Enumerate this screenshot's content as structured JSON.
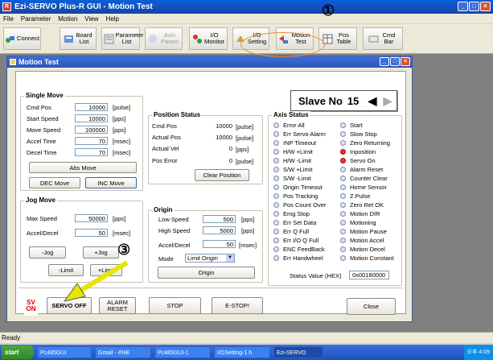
{
  "window": {
    "title": "Ezi-SERVO Plus-R GUI - Motion Test",
    "app_icon": "R"
  },
  "menu": [
    "File",
    "Parameter",
    "Motion",
    "View",
    "Help"
  ],
  "toolbar": {
    "connect": "Connect",
    "board_list": "Board List",
    "parameter_list": "Parameter List",
    "axis_param": "Axis Param",
    "io_monitor": "I/O Monitor",
    "io_setting": "I/O Setting",
    "motion_test": "Motion Test",
    "pos_table": "Pos Table",
    "cmd_bar": "Cmd Bar"
  },
  "child_window": {
    "title": "Motion Test"
  },
  "slave": {
    "label": "Slave No",
    "number": "15"
  },
  "single_move": {
    "title": "Single Move",
    "rows": [
      {
        "label": "Cmd Pos",
        "value": "10000",
        "unit": "[pulse]"
      },
      {
        "label": "Start Speed",
        "value": "10000",
        "unit": "[pps]"
      },
      {
        "label": "Move Speed",
        "value": "100000",
        "unit": "[pps]"
      },
      {
        "label": "Accel Time",
        "value": "70",
        "unit": "[msec]"
      },
      {
        "label": "Decel Time",
        "value": "70",
        "unit": "[msec]"
      }
    ],
    "abs_move": "Abs Move",
    "dec_move": "DEC Move",
    "inc_move": "INC Move"
  },
  "jog_move": {
    "title": "Jog Move",
    "rows": [
      {
        "label": "Max Speed",
        "value": "50000",
        "unit": "[pps]"
      },
      {
        "label": "Accel/Decel",
        "value": "50",
        "unit": "[msec]"
      }
    ],
    "minus_jog": "-Jog",
    "plus_jog": "+Jog",
    "minus_limit": "-Limit",
    "plus_limit": "+Limit"
  },
  "position_status": {
    "title": "Position Status",
    "rows": [
      {
        "label": "Cmd Pos",
        "value": "10000",
        "unit": "[pulse]"
      },
      {
        "label": "Actual Pos",
        "value": "10000",
        "unit": "[pulse]"
      },
      {
        "label": "Actual Vel",
        "value": "0",
        "unit": "[pps]"
      },
      {
        "label": "Pos Error",
        "value": "0",
        "unit": "[pulse]"
      }
    ],
    "clear": "Clear Position"
  },
  "origin": {
    "title": "Origin",
    "rows": [
      {
        "label": "Low Speed",
        "value": "500",
        "unit": "[pps]"
      },
      {
        "label": "High Speed",
        "value": "5000",
        "unit": "[pps]"
      },
      {
        "label": "Accel/Decel",
        "value": "50",
        "unit": "[msec]"
      }
    ],
    "mode_label": "Mode",
    "mode_value": "Limit Origin",
    "origin_button": "Origin"
  },
  "axis_status": {
    "title": "Axis Status",
    "left": [
      {
        "label": "Error All",
        "on": false
      },
      {
        "label": "Err Servo Alarm",
        "on": false
      },
      {
        "label": "INP Timeout",
        "on": false
      },
      {
        "label": "H/W +Limit",
        "on": false
      },
      {
        "label": "H/W -Limit",
        "on": false
      },
      {
        "label": "S/W +Limit",
        "on": false
      },
      {
        "label": "S/W -Limit",
        "on": false
      },
      {
        "label": "Origin Timeout",
        "on": false
      },
      {
        "label": "Pos Tracking",
        "on": false
      },
      {
        "label": "Pos Count Over",
        "on": false
      },
      {
        "label": "Emg Stop",
        "on": false
      },
      {
        "label": "Err Set Data",
        "on": false
      },
      {
        "label": "Err Q Full",
        "on": false
      },
      {
        "label": "Err I/O Q Full",
        "on": false
      },
      {
        "label": "ENC FeedBack",
        "on": false
      },
      {
        "label": "Err Handwheel",
        "on": false
      }
    ],
    "right": [
      {
        "label": "Start",
        "on": false
      },
      {
        "label": "Slow Stop",
        "on": false
      },
      {
        "label": "Zero Returning",
        "on": false
      },
      {
        "label": "Inposition",
        "on": true
      },
      {
        "label": "Servo On",
        "on": true
      },
      {
        "label": "Alarm Reset",
        "on": false
      },
      {
        "label": "Counter Clear",
        "on": false
      },
      {
        "label": "Home Sensor",
        "on": false
      },
      {
        "label": "Z Pulse",
        "on": false
      },
      {
        "label": "Zero Ret OK",
        "on": false
      },
      {
        "label": "Motion DIR",
        "on": false
      },
      {
        "label": "Motioning",
        "on": false
      },
      {
        "label": "Motion Pause",
        "on": false
      },
      {
        "label": "Motion Accel",
        "on": false
      },
      {
        "label": "Motion Decel",
        "on": false
      },
      {
        "label": "Motion Constant",
        "on": false
      }
    ],
    "status_value_label": "Status Value (HEX)",
    "status_value": "0x00180000"
  },
  "bottom": {
    "sv_icon_text": "SV ON",
    "servo_off": "SERVO OFF",
    "alarm_reset": "ALARM RESET",
    "stop": "STOP",
    "estop": "E-STOP!",
    "close": "Close"
  },
  "annotations": {
    "one": "①",
    "three": "③"
  },
  "statusbar": "Ready",
  "taskbar": {
    "start": "start",
    "tasks": [
      "Pc485GUI",
      "Gmail - 4%E",
      "Pc485GUI-1",
      "I/OSetting-1 h",
      "Ezi-SERVO"
    ],
    "clock": "오후 4:09"
  },
  "colors": {
    "annotation": "#f08a2c",
    "arrow": "#e6e600",
    "led_on": "#e33333"
  }
}
